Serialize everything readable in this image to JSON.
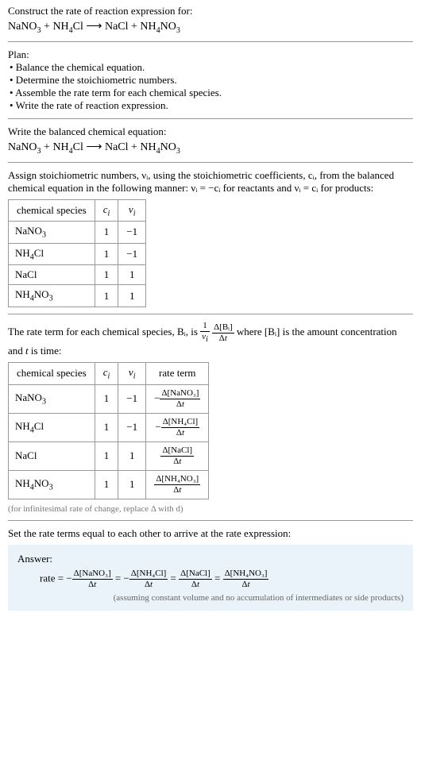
{
  "title": "Construct the rate of reaction expression for:",
  "equation_str": "NaNO₃ + NH₄Cl ⟶ NaCl + NH₄NO₃",
  "plan": {
    "heading": "Plan:",
    "items": [
      "• Balance the chemical equation.",
      "• Determine the stoichiometric numbers.",
      "• Assemble the rate term for each chemical species.",
      "• Write the rate of reaction expression."
    ]
  },
  "balanced_heading": "Write the balanced chemical equation:",
  "stoich_text_1": "Assign stoichiometric numbers, νᵢ, using the stoichiometric coefficients, cᵢ, from the balanced chemical equation in the following manner: νᵢ = −cᵢ for reactants and νᵢ = cᵢ for products:",
  "table1": {
    "headers": [
      "chemical species",
      "cᵢ",
      "νᵢ"
    ],
    "rows": [
      {
        "species": "NaNO₃",
        "c": "1",
        "v": "−1"
      },
      {
        "species": "NH₄Cl",
        "c": "1",
        "v": "−1"
      },
      {
        "species": "NaCl",
        "c": "1",
        "v": "1"
      },
      {
        "species": "NH₄NO₃",
        "c": "1",
        "v": "1"
      }
    ]
  },
  "rate_text_prefix": "The rate term for each chemical species, Bᵢ, is ",
  "rate_frac_num": "1",
  "rate_frac_den": "νᵢ",
  "rate_frac2_num": "Δ[Bᵢ]",
  "rate_frac2_den": "Δt",
  "rate_text_mid": " where [Bᵢ] is the amount concentration and ",
  "rate_text_t": "t",
  "rate_text_end": " is time:",
  "table2": {
    "headers": [
      "chemical species",
      "cᵢ",
      "νᵢ",
      "rate term"
    ],
    "rows": [
      {
        "species": "NaNO₃",
        "c": "1",
        "v": "−1",
        "num": "Δ[NaNO₃]",
        "den": "Δt",
        "neg": true
      },
      {
        "species": "NH₄Cl",
        "c": "1",
        "v": "−1",
        "num": "Δ[NH₄Cl]",
        "den": "Δt",
        "neg": true
      },
      {
        "species": "NaCl",
        "c": "1",
        "v": "1",
        "num": "Δ[NaCl]",
        "den": "Δt",
        "neg": false
      },
      {
        "species": "NH₄NO₃",
        "c": "1",
        "v": "1",
        "num": "Δ[NH₄NO₃]",
        "den": "Δt",
        "neg": false
      }
    ]
  },
  "infinitesimal_note": "(for infinitesimal rate of change, replace Δ with d)",
  "final_heading": "Set the rate terms equal to each other to arrive at the rate expression:",
  "answer": {
    "label": "Answer:",
    "prefix": "rate = ",
    "terms": [
      {
        "neg": true,
        "num": "Δ[NaNO₃]",
        "den": "Δt"
      },
      {
        "neg": true,
        "num": "Δ[NH₄Cl]",
        "den": "Δt"
      },
      {
        "neg": false,
        "num": "Δ[NaCl]",
        "den": "Δt"
      },
      {
        "neg": false,
        "num": "Δ[NH₄NO₃]",
        "den": "Δt"
      }
    ],
    "note": "(assuming constant volume and no accumulation of intermediates or side products)"
  }
}
